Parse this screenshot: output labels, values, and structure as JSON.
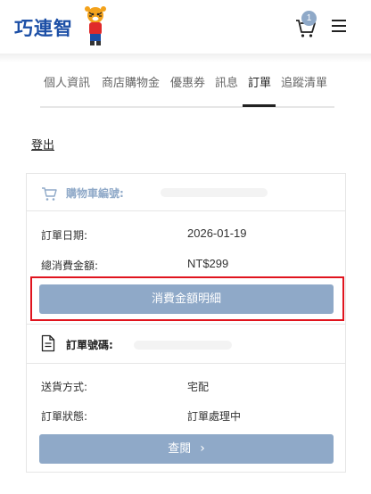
{
  "header": {
    "logo_text": "巧連智",
    "cart_count": "1"
  },
  "tabs": [
    {
      "label": "個人資訊"
    },
    {
      "label": "商店購物金"
    },
    {
      "label": "優惠券"
    },
    {
      "label": "訊息"
    },
    {
      "label": "訂單"
    },
    {
      "label": "追蹤清單"
    }
  ],
  "active_tab": "訂單",
  "logout_label": "登出",
  "order": {
    "cart_no_label": "購物車編號:",
    "date_label": "訂單日期:",
    "date_value": "2026-01-19",
    "total_label": "總消費金額:",
    "total_value": "NT$299",
    "detail_button": "消費金額明細",
    "order_no_label": "訂單號碼:",
    "shipping_label": "送貨方式:",
    "shipping_value": "宅配",
    "status_label": "訂單狀態:",
    "status_value": "訂單處理中",
    "view_button": "查閱"
  },
  "colors": {
    "accent": "#8fa9c8",
    "brand": "#1c4fa6",
    "highlight": "#e0141e"
  },
  "icons": [
    "cart-icon",
    "menu-icon",
    "shopping-cart-outline-icon",
    "document-icon",
    "chevron-right-icon"
  ]
}
